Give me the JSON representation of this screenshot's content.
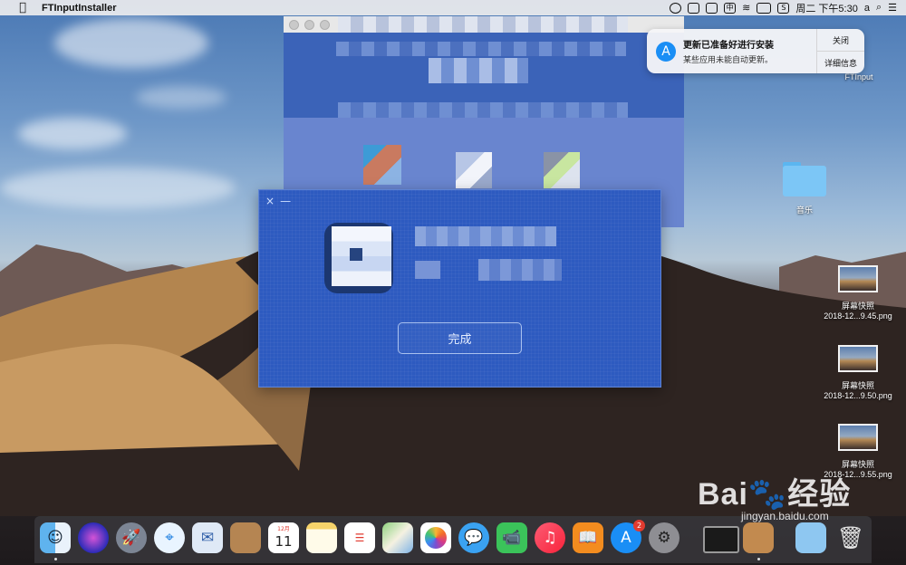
{
  "menubar": {
    "app_name": "FTInputInstaller",
    "clock": "周二 下午5:30",
    "input_source": "a",
    "status_icons": [
      "creative-cloud-icon",
      "camera-icon",
      "microphone-icon",
      "chinese-input-icon",
      "wifi-icon",
      "battery-icon",
      "sogou-icon",
      "search-icon",
      "menu-list-icon"
    ]
  },
  "notification": {
    "title": "更新已准备好进行安装",
    "body": "某些应用未能自动更新。",
    "close_label": "关闭",
    "details_label": "详细信息"
  },
  "desktop_icons": {
    "ftinput": {
      "label": "FTInput"
    },
    "music_folder": {
      "label": "音乐"
    },
    "screenshots": [
      {
        "title": "屏幕快照",
        "file": "2018-12...9.45.png"
      },
      {
        "title": "屏幕快照",
        "file": "2018-12...9.50.png"
      },
      {
        "title": "屏幕快照",
        "file": "2018-12...9.55.png"
      }
    ]
  },
  "installer": {
    "done_label": "完成",
    "close_glyph": "×",
    "minimize_glyph": "—"
  },
  "dock": {
    "apps": [
      "finder",
      "siri",
      "launchpad",
      "safari",
      "mail",
      "contacts",
      "calendar",
      "notes",
      "reminders",
      "maps",
      "photos",
      "messages",
      "facetime",
      "itunes",
      "books",
      "app-store",
      "system-preferences",
      "terminal",
      "preview",
      "folder",
      "trash"
    ],
    "calendar_month": "12月",
    "calendar_day": "11",
    "app_store_badge": "2"
  },
  "watermark": {
    "brand": "Bai",
    "brand_suffix": "经验",
    "url": "jingyan.baidu.com"
  }
}
